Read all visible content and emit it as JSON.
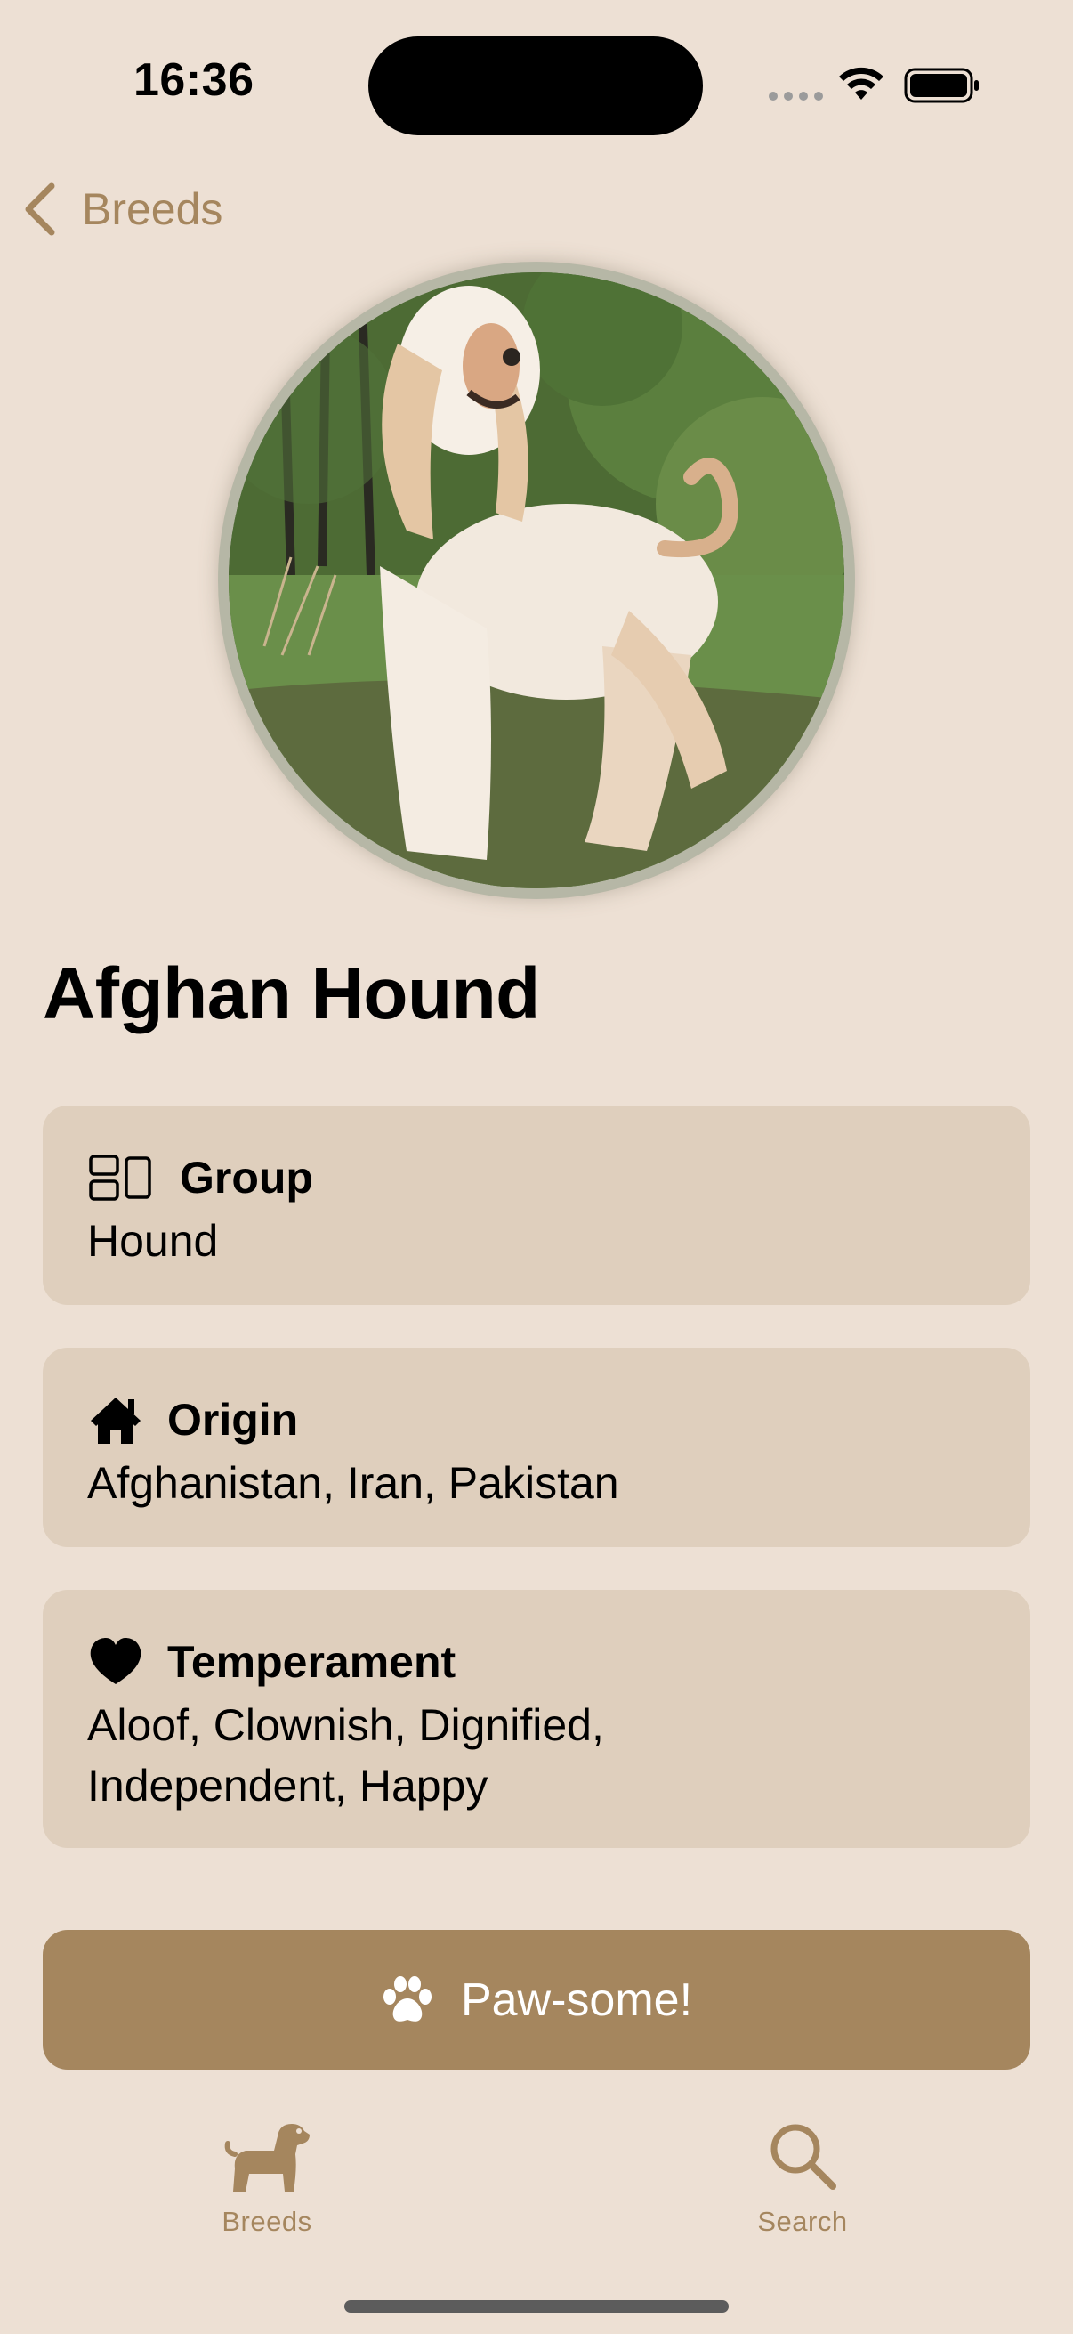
{
  "status_bar": {
    "time": "16:36"
  },
  "nav": {
    "back_label": "Breeds"
  },
  "breed": {
    "name": "Afghan Hound",
    "photo_icon": "dog-photo"
  },
  "cards": {
    "group": {
      "label": "Group",
      "value": "Hound",
      "icon": "group-icon"
    },
    "origin": {
      "label": "Origin",
      "value": "Afghanistan, Iran, Pakistan",
      "icon": "house-icon"
    },
    "temperament": {
      "label": "Temperament",
      "value": "Aloof, Clownish, Dignified, Independent, Happy",
      "icon": "heart-icon"
    }
  },
  "action_button": {
    "label": "Paw-some!",
    "icon": "paw-icon"
  },
  "tab_bar": {
    "tabs": [
      {
        "label": "Breeds",
        "icon": "dog-icon",
        "selected": true
      },
      {
        "label": "Search",
        "icon": "search-icon",
        "selected": false
      }
    ]
  },
  "colors": {
    "background": "#ede0d4",
    "card": "#dfcfbd",
    "accent": "#a5865e"
  }
}
